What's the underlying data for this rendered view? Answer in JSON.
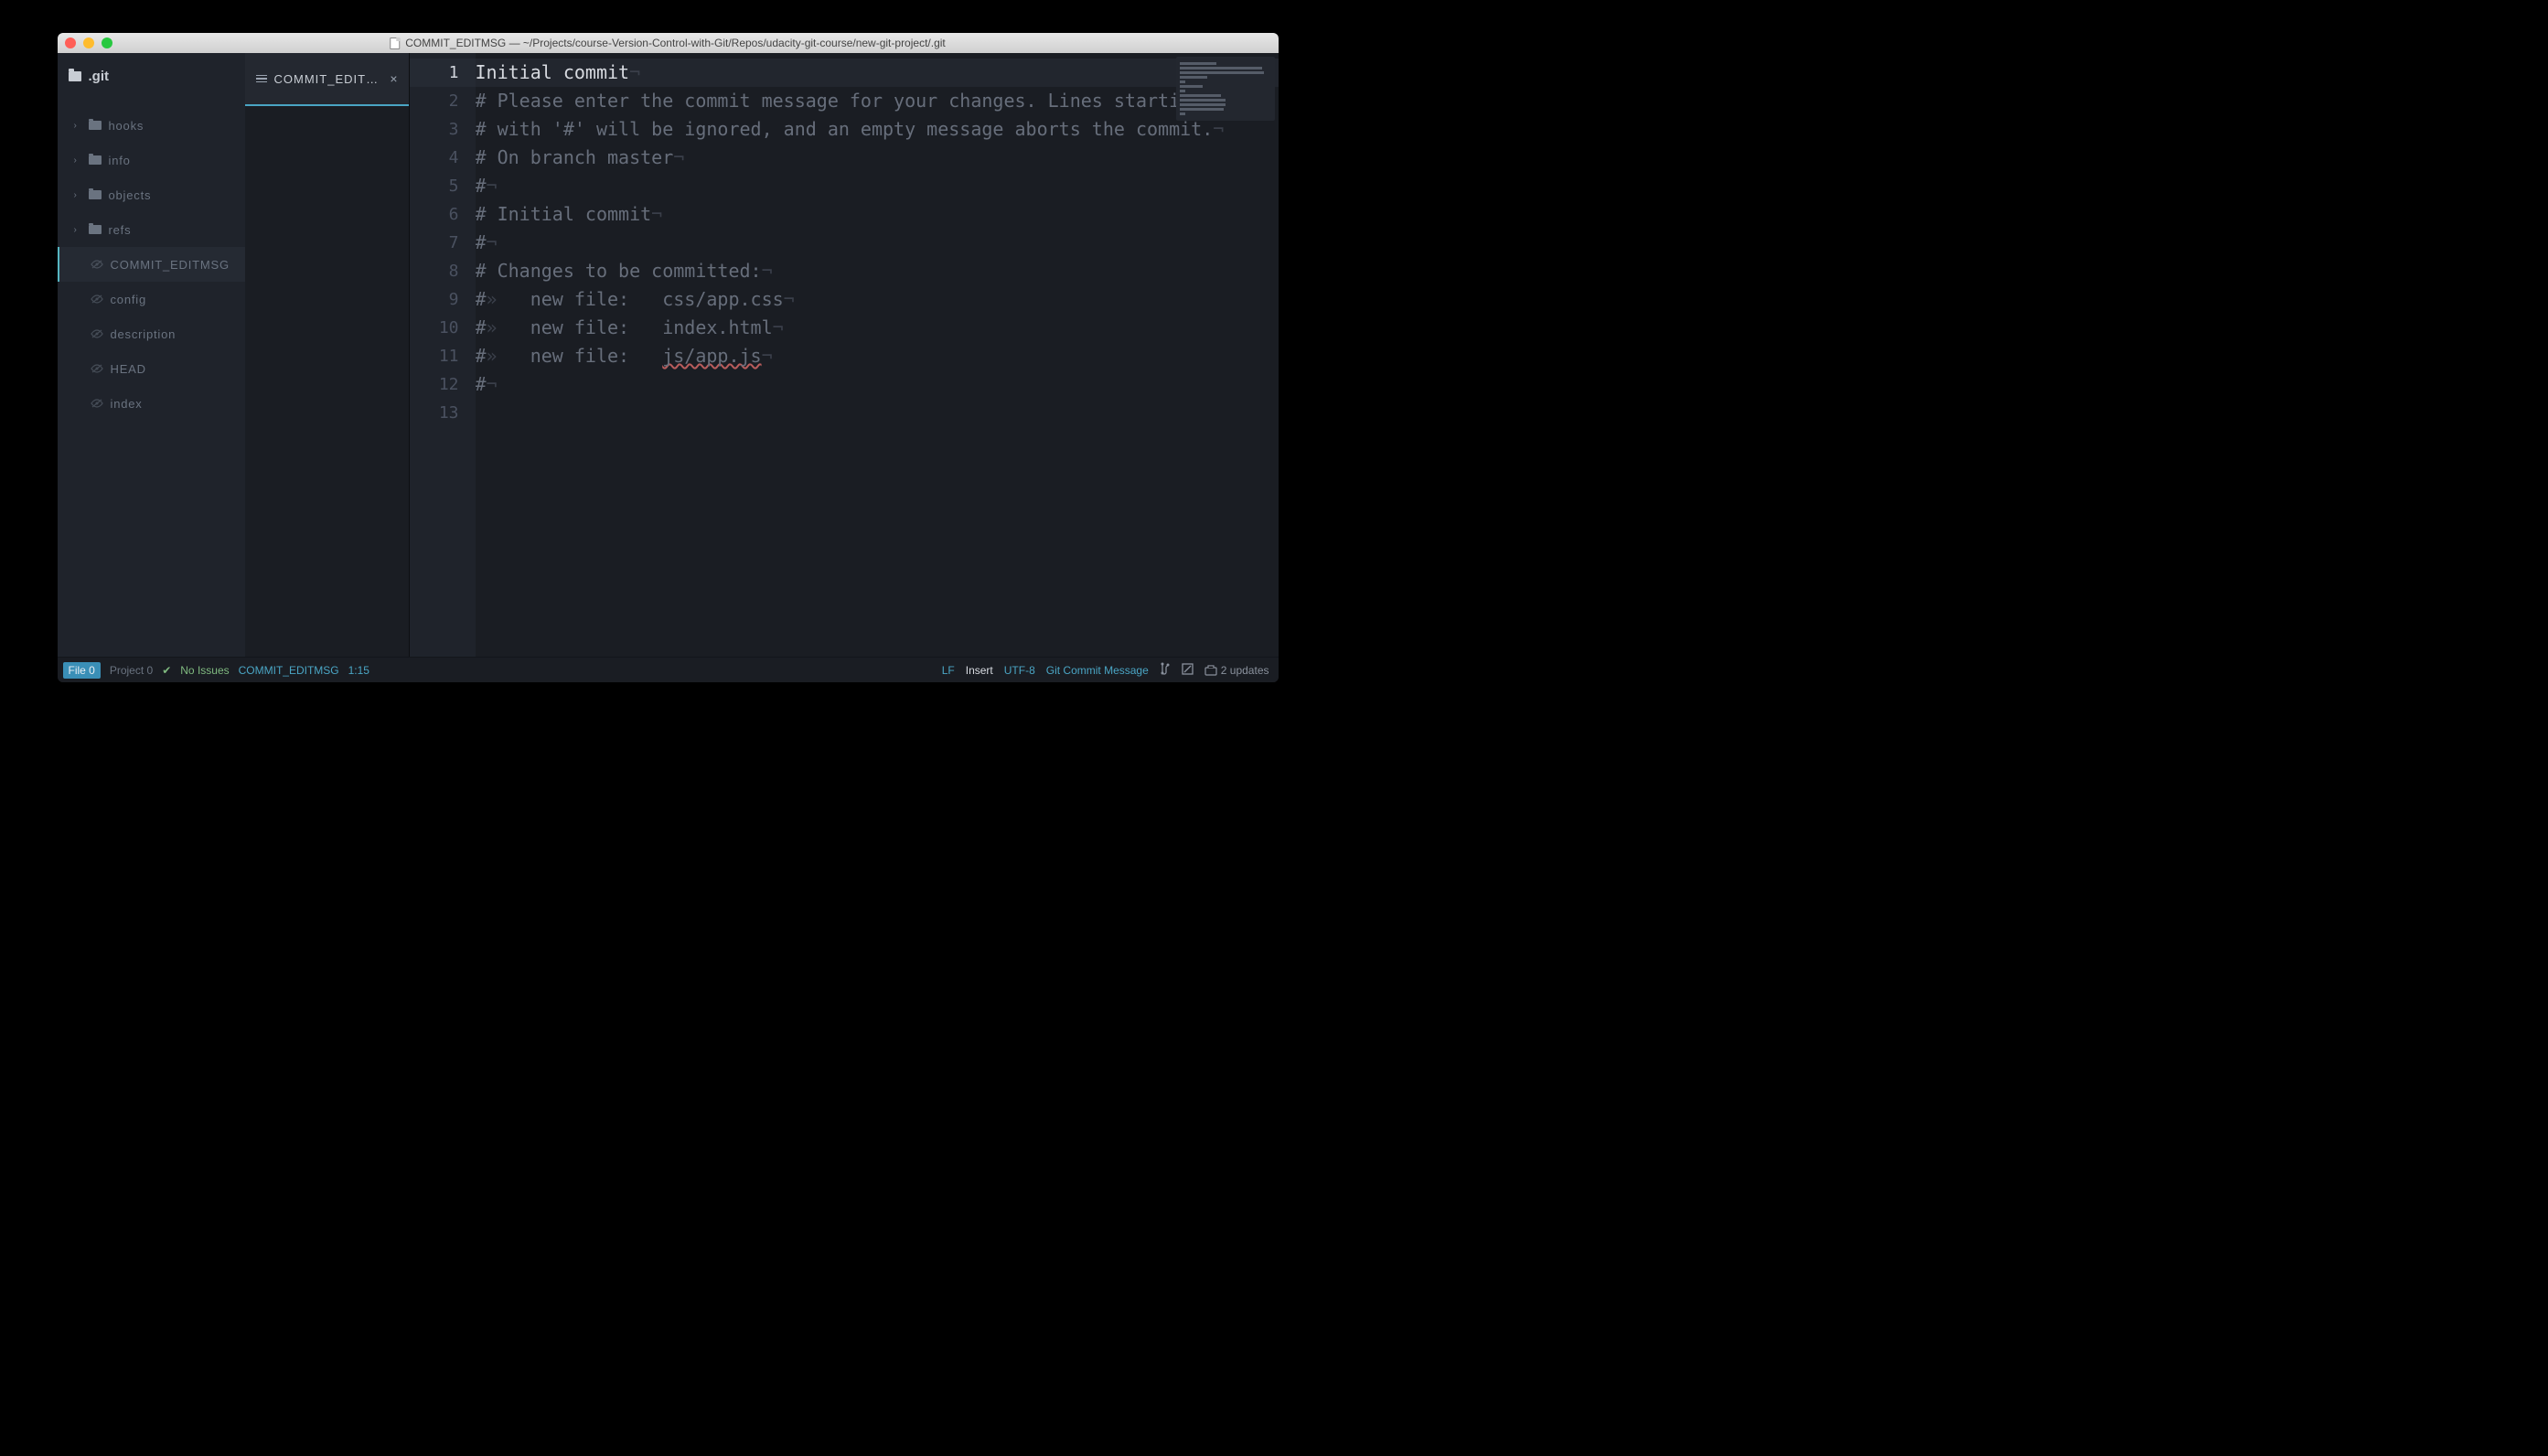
{
  "window": {
    "title": "COMMIT_EDITMSG — ~/Projects/course-Version-Control-with-Git/Repos/udacity-git-course/new-git-project/.git"
  },
  "sidebar": {
    "project": ".git",
    "folders": [
      {
        "name": "hooks"
      },
      {
        "name": "info"
      },
      {
        "name": "objects"
      },
      {
        "name": "refs"
      }
    ],
    "files": [
      {
        "name": "COMMIT_EDITMSG",
        "active": true
      },
      {
        "name": "config"
      },
      {
        "name": "description"
      },
      {
        "name": "HEAD"
      },
      {
        "name": "index"
      }
    ]
  },
  "tab": {
    "label": "COMMIT_EDITMS…"
  },
  "editor": {
    "line_count": 13,
    "current_line": 1,
    "lines": [
      {
        "segments": [
          {
            "t": "Initial commit",
            "c": "plain"
          },
          {
            "t": "¬",
            "c": "inv"
          }
        ]
      },
      {
        "segments": [
          {
            "t": "# Please enter the commit message for your changes. Lines starting",
            "c": ""
          },
          {
            "t": "¬",
            "c": "inv"
          }
        ]
      },
      {
        "segments": [
          {
            "t": "# with '#' will be ignored, and an empty message aborts the commit.",
            "c": ""
          },
          {
            "t": "¬",
            "c": "inv"
          }
        ]
      },
      {
        "segments": [
          {
            "t": "# On branch master",
            "c": ""
          },
          {
            "t": "¬",
            "c": "inv"
          }
        ]
      },
      {
        "segments": [
          {
            "t": "#",
            "c": ""
          },
          {
            "t": "¬",
            "c": "inv"
          }
        ]
      },
      {
        "segments": [
          {
            "t": "# Initial commit",
            "c": ""
          },
          {
            "t": "¬",
            "c": "inv"
          }
        ]
      },
      {
        "segments": [
          {
            "t": "#",
            "c": ""
          },
          {
            "t": "¬",
            "c": "inv"
          }
        ]
      },
      {
        "segments": [
          {
            "t": "# Changes to be committed:",
            "c": ""
          },
          {
            "t": "¬",
            "c": "inv"
          }
        ]
      },
      {
        "segments": [
          {
            "t": "#",
            "c": ""
          },
          {
            "t": "»",
            "c": "inv"
          },
          {
            "t": "   new file:   css/app.css",
            "c": ""
          },
          {
            "t": "¬",
            "c": "inv"
          }
        ]
      },
      {
        "segments": [
          {
            "t": "#",
            "c": ""
          },
          {
            "t": "»",
            "c": "inv"
          },
          {
            "t": "   new file:   index.html",
            "c": ""
          },
          {
            "t": "¬",
            "c": "inv"
          }
        ]
      },
      {
        "segments": [
          {
            "t": "#",
            "c": ""
          },
          {
            "t": "»",
            "c": "inv"
          },
          {
            "t": "   new file:   ",
            "c": ""
          },
          {
            "t": "js/app.js",
            "c": "underlined"
          },
          {
            "t": "¬",
            "c": "inv"
          }
        ]
      },
      {
        "segments": [
          {
            "t": "#",
            "c": ""
          },
          {
            "t": "¬",
            "c": "inv"
          }
        ]
      },
      {
        "segments": []
      }
    ]
  },
  "status": {
    "file_pill": "File 0",
    "project": "Project 0",
    "issues": "No Issues",
    "filename": "COMMIT_EDITMSG",
    "position": "1:15",
    "line_ending": "LF",
    "mode": "Insert",
    "encoding": "UTF-8",
    "language": "Git Commit Message",
    "updates": "2 updates"
  }
}
